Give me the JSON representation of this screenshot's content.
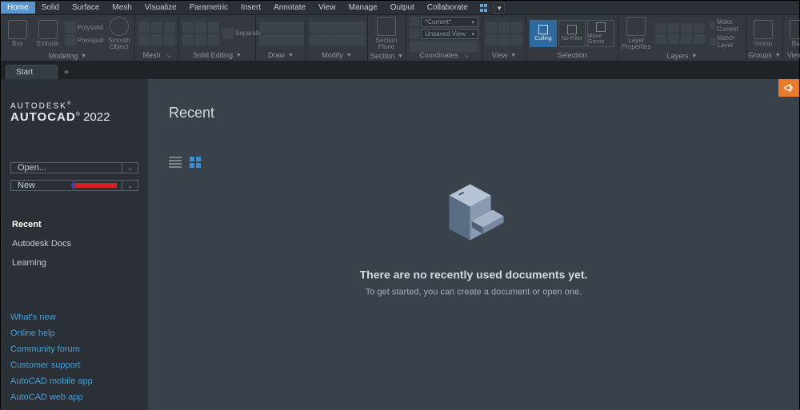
{
  "menubar": [
    "Home",
    "Solid",
    "Surface",
    "Mesh",
    "Visualize",
    "Parametric",
    "Insert",
    "Annotate",
    "View",
    "Manage",
    "Output",
    "Collaborate"
  ],
  "ribbon": {
    "panels": [
      {
        "label": "Modeling",
        "arrow": true,
        "big": [
          {
            "lbl": "Box"
          },
          {
            "lbl": "Extrude"
          }
        ],
        "side": [
          {
            "lbl": "Polysolid"
          },
          {
            "lbl": "Presspull"
          }
        ],
        "extra": "Smooth Object"
      },
      {
        "label": "Mesh",
        "arrow": false
      },
      {
        "label": "Solid Editing",
        "arrow": true,
        "side": [
          {
            "lbl": "Separate"
          }
        ]
      },
      {
        "label": "Draw",
        "arrow": true
      },
      {
        "label": "Modify",
        "arrow": true
      },
      {
        "label": "Section",
        "arrow": true,
        "big": [
          {
            "lbl": "Section Plane"
          }
        ]
      },
      {
        "label": "Coordinates",
        "arrow": false,
        "selects": [
          "*Current*",
          "Unsaved View"
        ]
      },
      {
        "label": "View",
        "arrow": true
      },
      {
        "label": "Selection",
        "arrow": false,
        "toggles": [
          {
            "lbl": "Culling",
            "on": true
          },
          {
            "lbl": "No Filter",
            "on": false
          },
          {
            "lbl": "Move Gizmo",
            "on": false
          }
        ]
      },
      {
        "label": "Layers",
        "arrow": true,
        "big": [
          {
            "lbl": "Layer Properties"
          }
        ],
        "pair": [
          "Make Current",
          "Match Layer"
        ]
      },
      {
        "label": "Groups",
        "arrow": true,
        "big": [
          {
            "lbl": "Group"
          }
        ]
      },
      {
        "label": "View",
        "arrow": true,
        "big": [
          {
            "lbl": "Base"
          }
        ]
      }
    ]
  },
  "tabs": {
    "start": "Start"
  },
  "sidebar": {
    "brand1": "AUTODESK",
    "brand2_bold": "AUTOCAD",
    "brand2_rest": " 2022",
    "open": "Open...",
    "new": "New",
    "nav": [
      "Recent",
      "Autodesk Docs",
      "Learning"
    ],
    "links": [
      "What's new",
      "Online help",
      "Community forum",
      "Customer support",
      "AutoCAD mobile app",
      "AutoCAD web app"
    ]
  },
  "content": {
    "heading": "Recent",
    "empty_title": "There are no recently used documents yet.",
    "empty_sub": "To get started, you can create a document or open one."
  },
  "reg": "®"
}
